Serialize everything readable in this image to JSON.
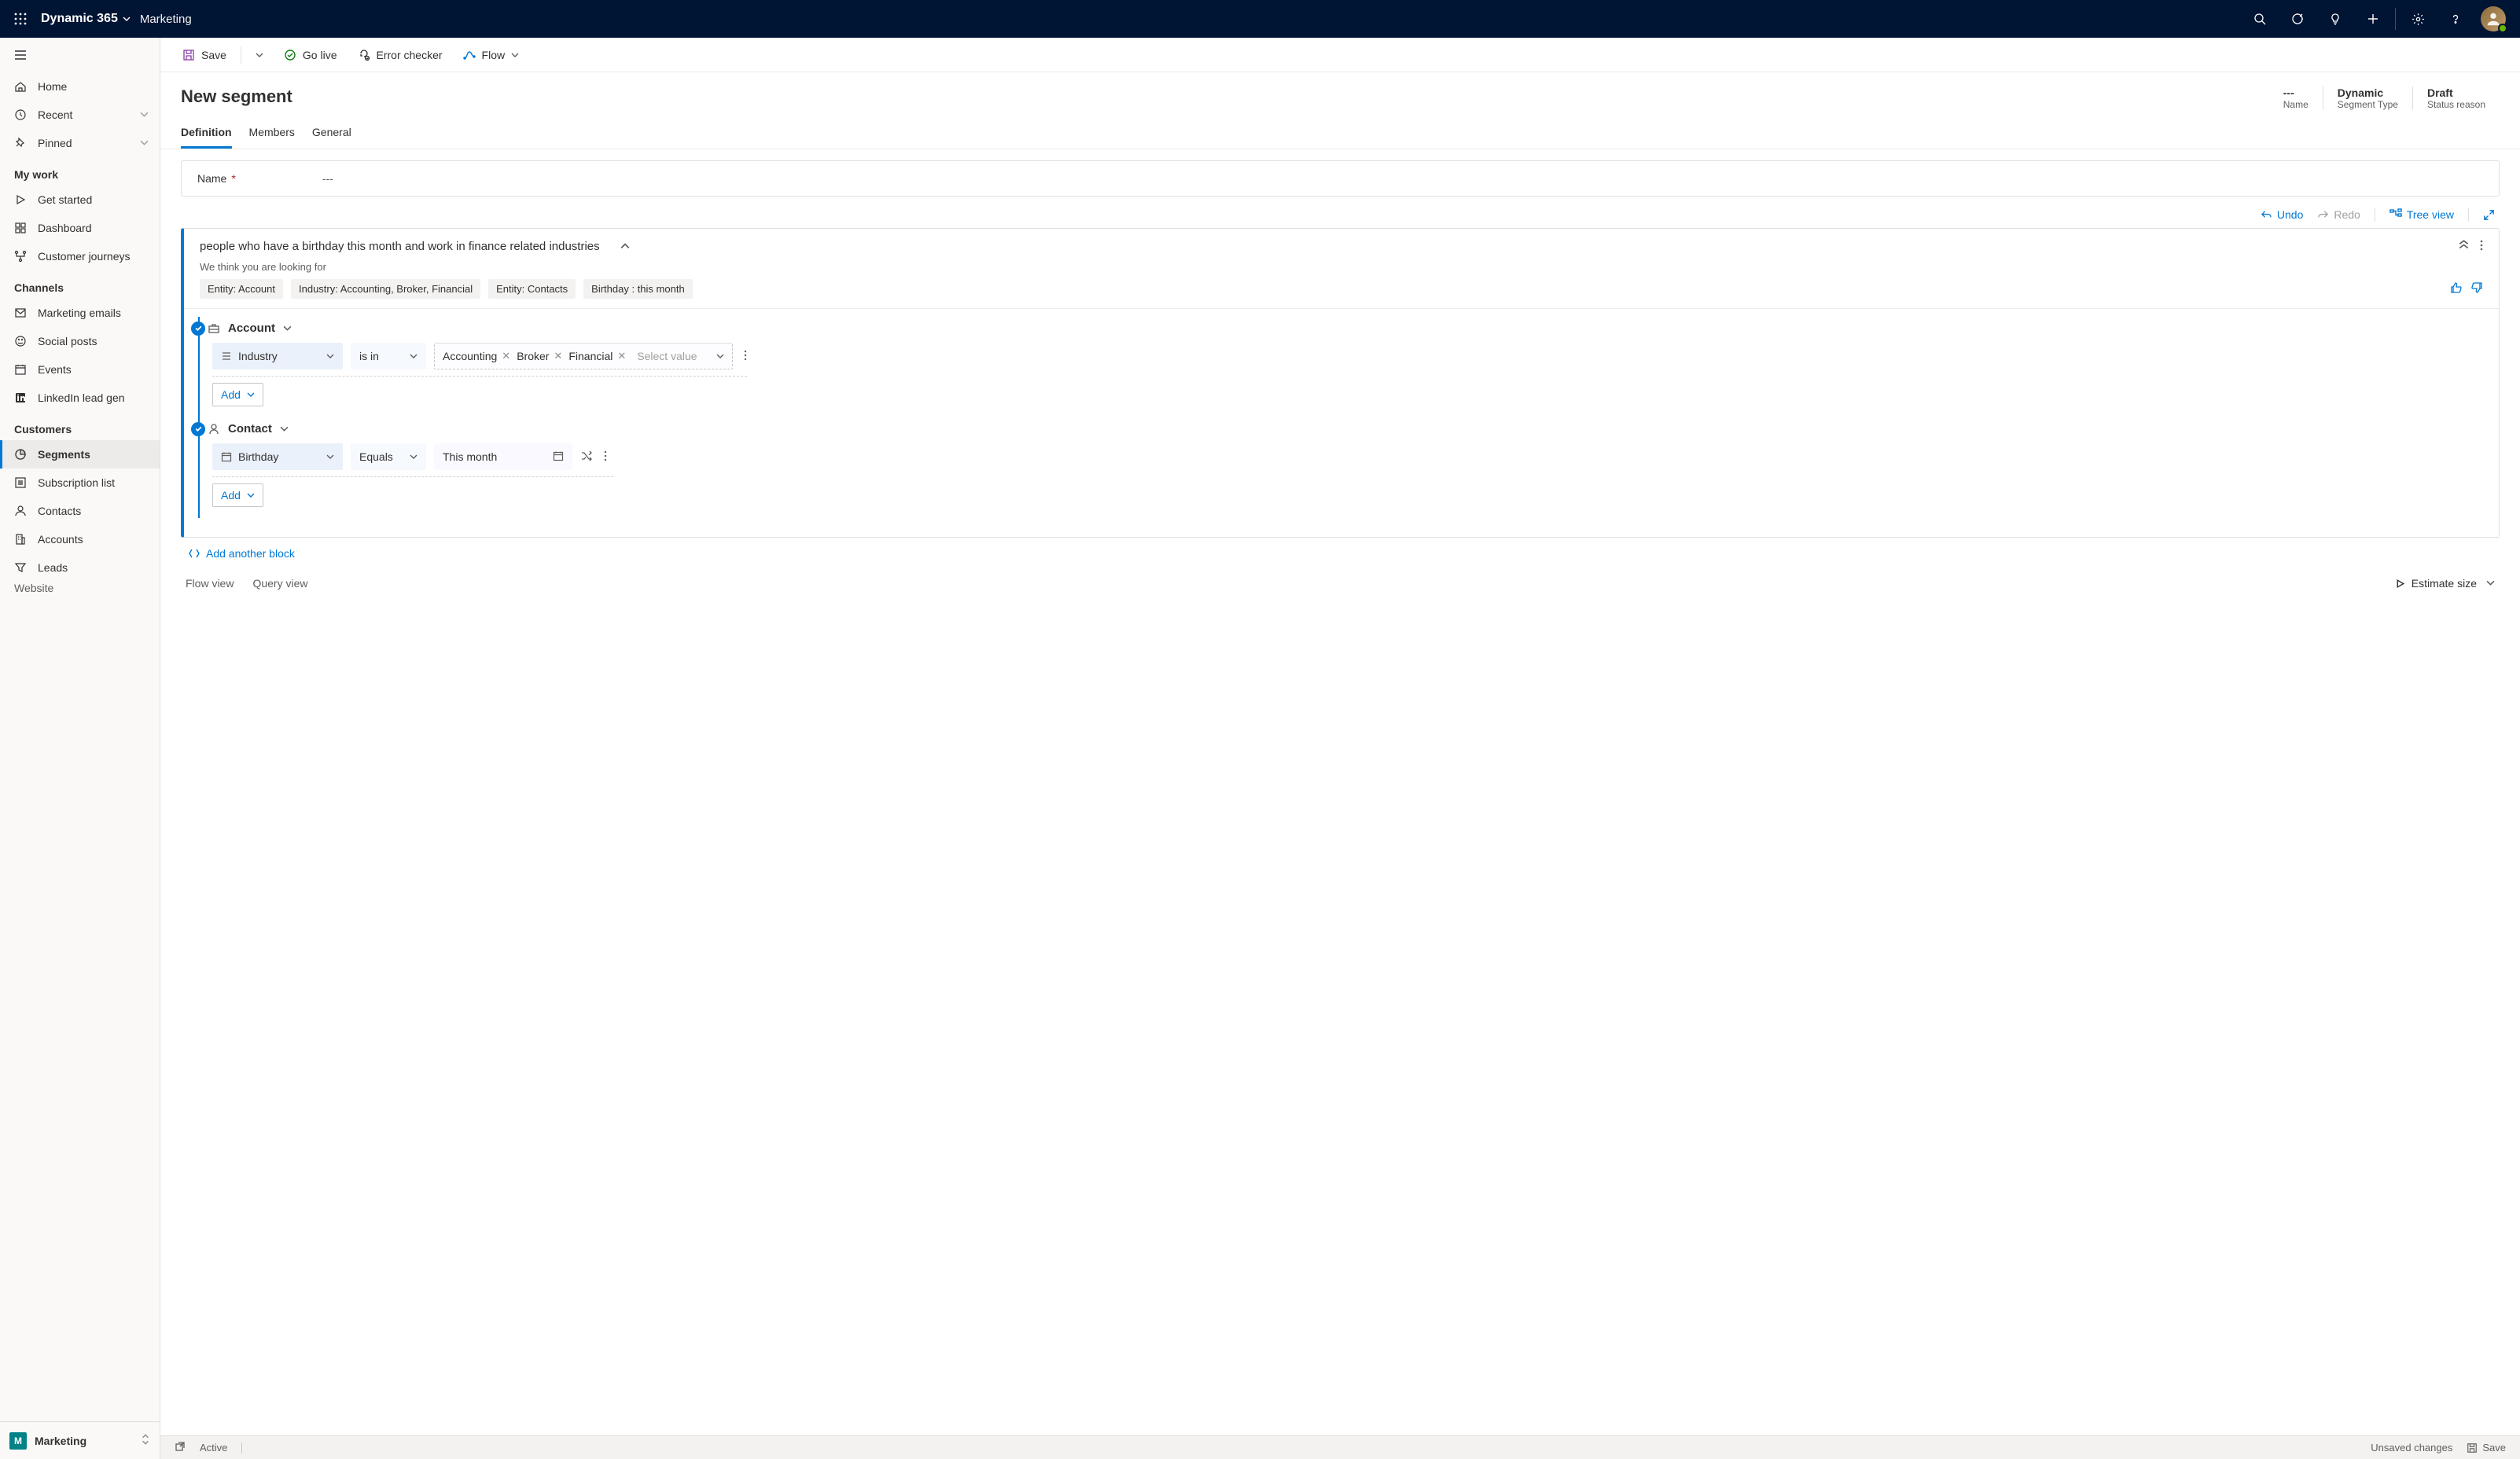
{
  "topbar": {
    "brand": "Dynamic 365",
    "app": "Marketing"
  },
  "sidebar": {
    "top": [
      {
        "icon": "home",
        "label": "Home"
      },
      {
        "icon": "recent",
        "label": "Recent",
        "expand": true
      },
      {
        "icon": "pin",
        "label": "Pinned",
        "expand": true
      }
    ],
    "groups": [
      {
        "header": "My work",
        "items": [
          {
            "icon": "play",
            "label": "Get started"
          },
          {
            "icon": "dashboard",
            "label": "Dashboard"
          },
          {
            "icon": "journey",
            "label": "Customer journeys"
          }
        ]
      },
      {
        "header": "Channels",
        "items": [
          {
            "icon": "mail",
            "label": "Marketing emails"
          },
          {
            "icon": "smile",
            "label": "Social posts"
          },
          {
            "icon": "calendar",
            "label": "Events"
          },
          {
            "icon": "linkedin",
            "label": "LinkedIn lead gen"
          }
        ]
      },
      {
        "header": "Customers",
        "items": [
          {
            "icon": "segments",
            "label": "Segments",
            "selected": true
          },
          {
            "icon": "sublist",
            "label": "Subscription list"
          },
          {
            "icon": "person",
            "label": "Contacts"
          },
          {
            "icon": "building",
            "label": "Accounts"
          },
          {
            "icon": "funnel",
            "label": "Leads"
          }
        ]
      }
    ],
    "truncated": "Website",
    "footer": {
      "badge": "M",
      "label": "Marketing"
    }
  },
  "commandbar": {
    "save": "Save",
    "golive": "Go live",
    "error": "Error checker",
    "flow": "Flow"
  },
  "header": {
    "title": "New segment",
    "fields": [
      {
        "val": "---",
        "lab": "Name"
      },
      {
        "val": "Dynamic",
        "lab": "Segment Type"
      },
      {
        "val": "Draft",
        "lab": "Status reason"
      }
    ]
  },
  "tabs": [
    "Definition",
    "Members",
    "General"
  ],
  "activeTab": 0,
  "nameRow": {
    "label": "Name",
    "value": "---"
  },
  "toolbar2": {
    "undo": "Undo",
    "redo": "Redo",
    "tree": "Tree view"
  },
  "block": {
    "query": "people who have a birthday this month and work in finance related industries",
    "hint": "We think you are looking for",
    "suggestions": [
      "Entity: Account",
      "Industry:  Accounting, Broker, Financial",
      "Entity: Contacts",
      "Birthday : this month"
    ],
    "entities": [
      {
        "name": "Account",
        "icon": "briefcase",
        "conditions": [
          {
            "field": "Industry",
            "fieldIcon": "list",
            "op": "is in",
            "values": [
              "Accounting",
              "Broker",
              "Financial"
            ],
            "placeholder": "Select value"
          }
        ],
        "add": "Add"
      },
      {
        "name": "Contact",
        "icon": "person",
        "conditions": [
          {
            "field": "Birthday",
            "fieldIcon": "bdate",
            "op": "Equals",
            "date": "This month"
          }
        ],
        "add": "Add"
      }
    ]
  },
  "addAnother": "Add another block",
  "footer": {
    "flow": "Flow view",
    "query": "Query view",
    "estimate": "Estimate size"
  },
  "statusbar": {
    "active": "Active",
    "unsaved": "Unsaved changes",
    "save": "Save"
  }
}
